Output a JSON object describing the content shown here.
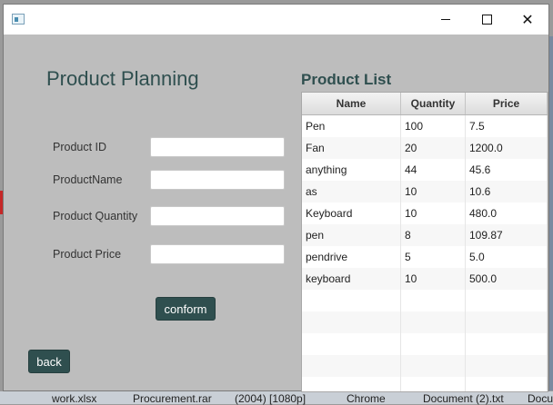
{
  "desktop": {
    "taskbar_items": [
      "work.xlsx",
      "Procurement.rar",
      "(2004) [1080p]",
      "Chrome",
      "Document (2).txt",
      "Docu"
    ]
  },
  "window": {
    "controls": {
      "minimize_icon": "minimize-icon",
      "maximize_icon": "maximize-icon",
      "close_symbol": "✕"
    }
  },
  "form": {
    "heading": "Product Planning",
    "fields": [
      {
        "label": "Product ID",
        "value": ""
      },
      {
        "label": "ProductName",
        "value": ""
      },
      {
        "label": "Product Quantity",
        "value": ""
      },
      {
        "label": "Product Price",
        "value": ""
      }
    ],
    "conform_label": "conform",
    "back_label": "back"
  },
  "product_list": {
    "title": "Product List",
    "columns": [
      "Name",
      "Quantity",
      "Price"
    ],
    "rows": [
      [
        "Pen",
        "100",
        "7.5"
      ],
      [
        "Fan",
        "20",
        "1200.0"
      ],
      [
        "anything",
        "44",
        "45.6"
      ],
      [
        "as",
        "10",
        "10.6"
      ],
      [
        "Keyboard",
        "10",
        "480.0"
      ],
      [
        "pen",
        "8",
        "109.87"
      ],
      [
        "pendrive",
        "5",
        "5.0"
      ],
      [
        "keyboard",
        "10",
        "500.0"
      ]
    ],
    "empty_rows": 5
  },
  "colors": {
    "accent": "#2f4f4f",
    "window_bg": "#bdbdbd"
  }
}
